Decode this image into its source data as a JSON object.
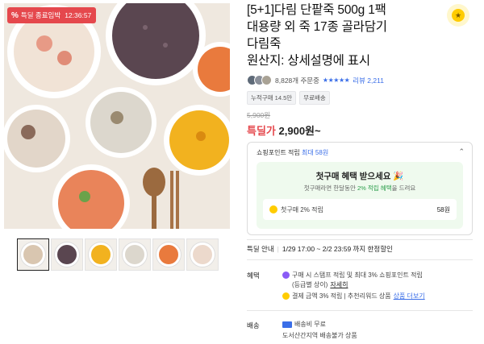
{
  "badge": {
    "icon": "percent-icon",
    "label": "특딜 종료임박",
    "timer": "12:36:57"
  },
  "product": {
    "title_lines": [
      "[5+1]다림 단팥죽 500g 1팩",
      "대용량 외 죽 17종 골라담기",
      "다림죽",
      "원산지: 상세설명에 표시"
    ]
  },
  "favorite": {
    "icon": "favorite-coin-icon",
    "glyph": "★"
  },
  "meta": {
    "orders": "8,828개 주문중",
    "stars": "★★★★★",
    "reviews": "리뷰 2,211"
  },
  "tags": [
    "누적구매 14.5만",
    "무료배송"
  ],
  "price": {
    "original": "5,900원",
    "deal_label": "특딜가",
    "deal_value": "2,900원~"
  },
  "points": {
    "header": "쇼핑포인트 적립",
    "header_max": "최대 58원",
    "chevron": "⌃",
    "card_title": "첫구매 혜택 받으세요 🎉",
    "card_sub_pre": "첫구매라면 한달동안 ",
    "card_sub_highlight": "2% 적립 혜택",
    "card_sub_post": "을 드려요",
    "row_label": "첫구매 2% 적립",
    "row_amount": "58원"
  },
  "deal_guide": {
    "label": "특딜 안내",
    "period": "1/29 17:00 ~ 2/2 23:59 까지 한정할인"
  },
  "benefits": {
    "label": "혜택",
    "line1_pre": "구매 시 스탬프 적립 및 최대 3% 쇼핑포인트 적립",
    "line1b_pre": "(등급별 상이) ",
    "line1b_link": "자세히",
    "line2_pre": "결제 금액 3% 적립 | 추천리워드 상품 ",
    "line2_link": "상품 더보기"
  },
  "shipping": {
    "label": "배송",
    "fee": "배송비 무료",
    "note": "도서산간지역 배송불가 상품"
  },
  "colors": {
    "accent_red": "#e5484d",
    "accent_blue": "#3a6ee8",
    "accent_green": "#2a9d4a"
  }
}
